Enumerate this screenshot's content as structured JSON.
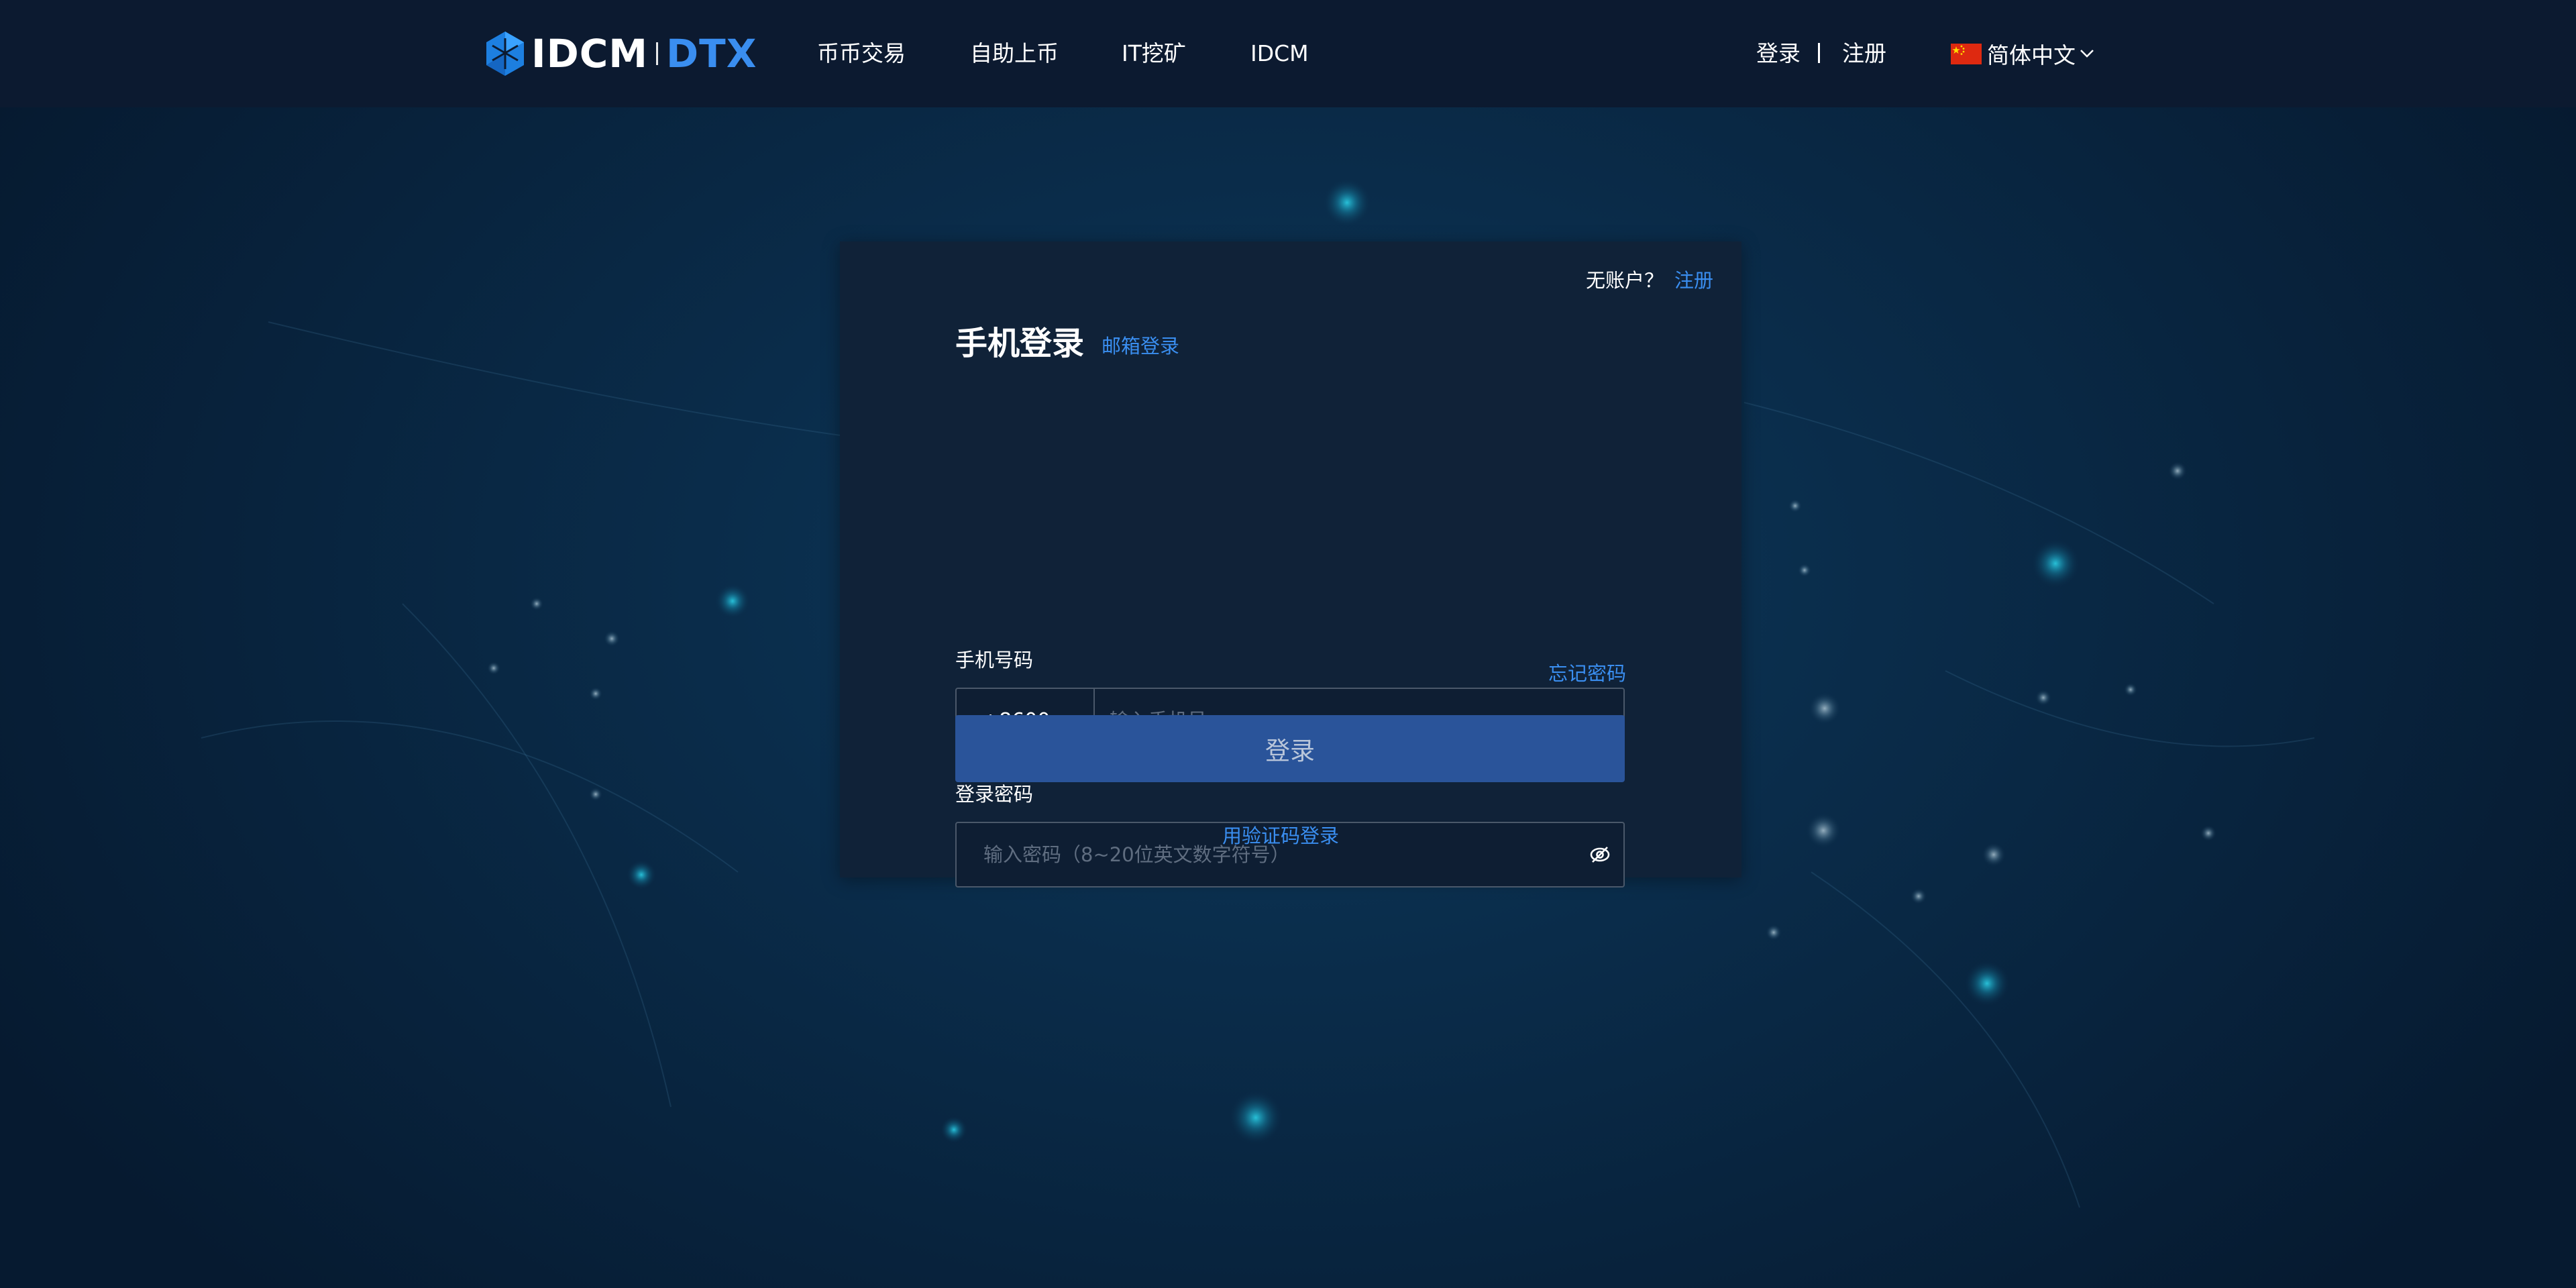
{
  "header": {
    "logo_left": "IDCM",
    "logo_right": "DTX",
    "nav": [
      {
        "label": "币币交易"
      },
      {
        "label": "自助上币"
      },
      {
        "label": "IT挖矿"
      },
      {
        "label": "IDCM"
      }
    ],
    "login_label": "登录",
    "register_label": "注册",
    "language_label": "简体中文"
  },
  "login_card": {
    "no_account_text": "无账户？",
    "register_link": "注册",
    "title": "手机登录",
    "email_login_link": "邮箱登录",
    "phone_label": "手机号码",
    "country_code": "+8600",
    "phone_placeholder": "输入手机号",
    "password_label": "登录密码",
    "password_placeholder": "输入密码（8~20位英文数字符号）",
    "forgot_password": "忘记密码",
    "login_button": "登录",
    "code_login_link": "用验证码登录"
  },
  "colors": {
    "header_bg": "#0c1a30",
    "page_bg": "#0a2c4a",
    "card_bg": "#102238",
    "accent": "#3a8ef0",
    "button_bg": "#2a549a"
  },
  "icons": {
    "logo": "idcm-hexagon-logo-icon",
    "caret": "caret-down-icon",
    "language_chevron": "chevron-down-icon",
    "flag": "china-flag-icon",
    "password_visibility": "eye-off-icon"
  }
}
